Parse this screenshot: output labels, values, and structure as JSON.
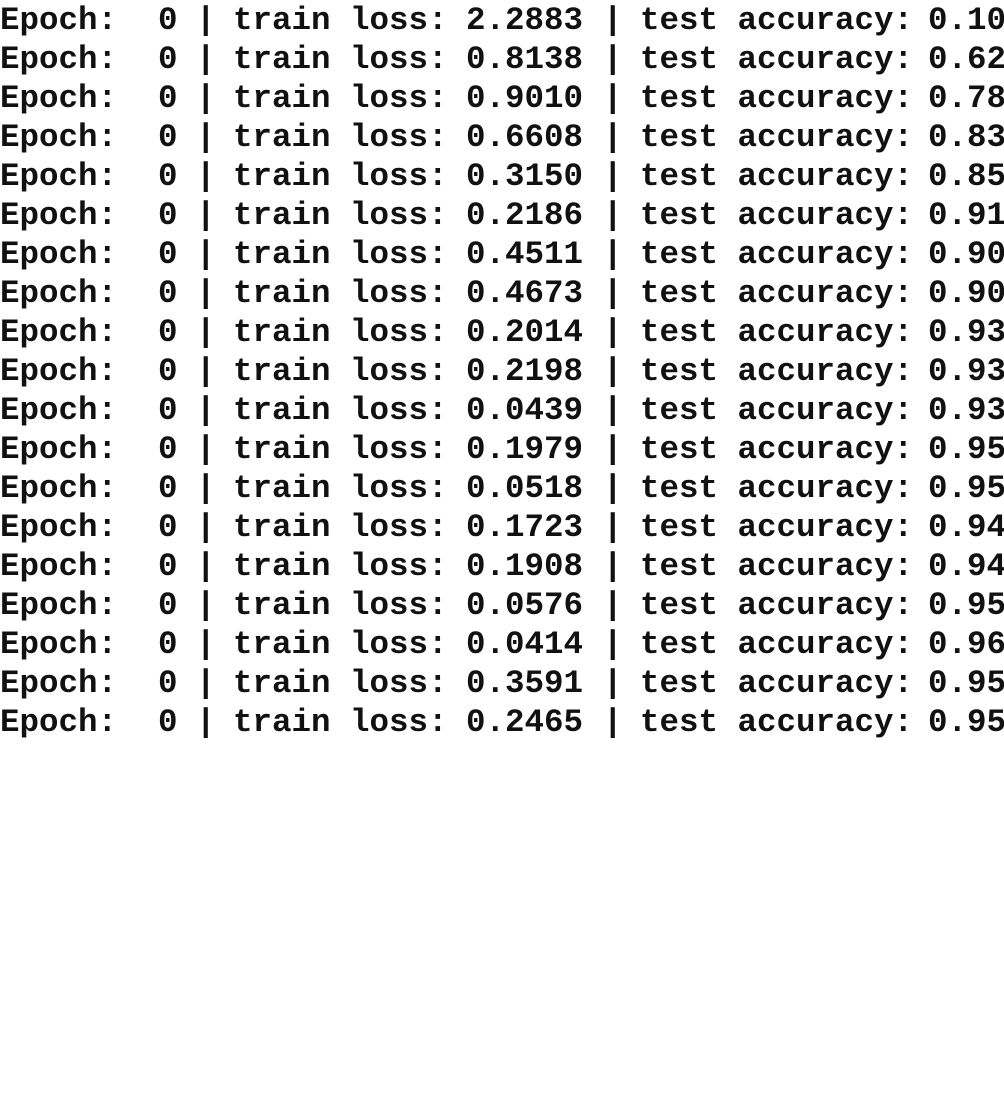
{
  "log": {
    "labels": {
      "epoch": "Epoch:",
      "loss": "train loss:",
      "accuracy": "test accuracy:",
      "separator": "|"
    },
    "lines": [
      {
        "epoch": "0",
        "train_loss": "2.2883",
        "test_accuracy": "0.10"
      },
      {
        "epoch": "0",
        "train_loss": "0.8138",
        "test_accuracy": "0.62"
      },
      {
        "epoch": "0",
        "train_loss": "0.9010",
        "test_accuracy": "0.78"
      },
      {
        "epoch": "0",
        "train_loss": "0.6608",
        "test_accuracy": "0.83"
      },
      {
        "epoch": "0",
        "train_loss": "0.3150",
        "test_accuracy": "0.85"
      },
      {
        "epoch": "0",
        "train_loss": "0.2186",
        "test_accuracy": "0.91"
      },
      {
        "epoch": "0",
        "train_loss": "0.4511",
        "test_accuracy": "0.90"
      },
      {
        "epoch": "0",
        "train_loss": "0.4673",
        "test_accuracy": "0.90"
      },
      {
        "epoch": "0",
        "train_loss": "0.2014",
        "test_accuracy": "0.93"
      },
      {
        "epoch": "0",
        "train_loss": "0.2198",
        "test_accuracy": "0.93"
      },
      {
        "epoch": "0",
        "train_loss": "0.0439",
        "test_accuracy": "0.93"
      },
      {
        "epoch": "0",
        "train_loss": "0.1979",
        "test_accuracy": "0.95"
      },
      {
        "epoch": "0",
        "train_loss": "0.0518",
        "test_accuracy": "0.95"
      },
      {
        "epoch": "0",
        "train_loss": "0.1723",
        "test_accuracy": "0.94"
      },
      {
        "epoch": "0",
        "train_loss": "0.1908",
        "test_accuracy": "0.94"
      },
      {
        "epoch": "0",
        "train_loss": "0.0576",
        "test_accuracy": "0.95"
      },
      {
        "epoch": "0",
        "train_loss": "0.0414",
        "test_accuracy": "0.96"
      },
      {
        "epoch": "0",
        "train_loss": "0.3591",
        "test_accuracy": "0.95"
      },
      {
        "epoch": "0",
        "train_loss": "0.2465",
        "test_accuracy": "0.95"
      }
    ]
  }
}
